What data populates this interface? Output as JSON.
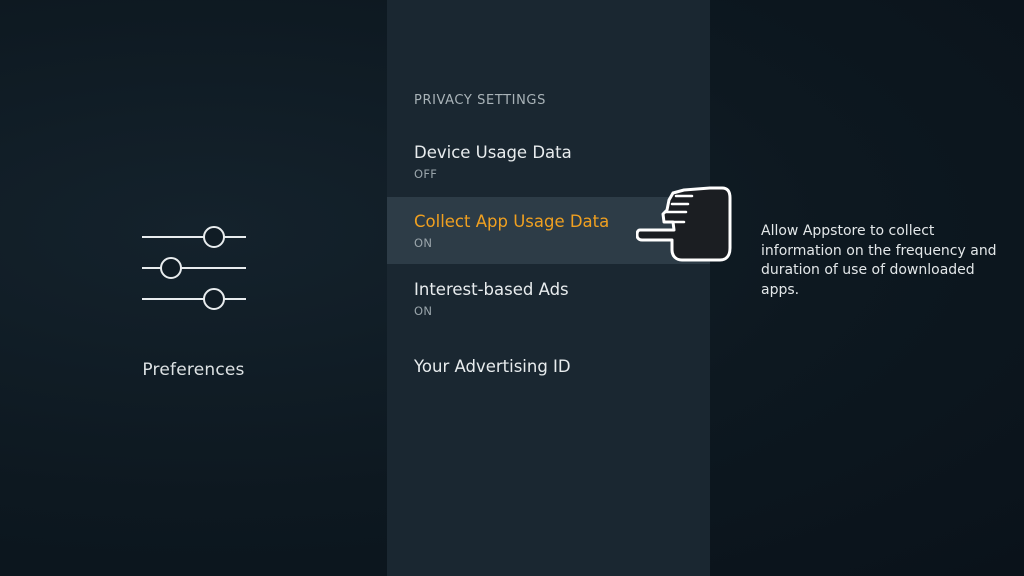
{
  "sidebar": {
    "category_label": "Preferences",
    "icon": "sliders-icon"
  },
  "settings": {
    "section_header": "PRIVACY SETTINGS",
    "items": [
      {
        "title": "Device Usage Data",
        "status": "OFF",
        "selected": false
      },
      {
        "title": "Collect App Usage Data",
        "status": "ON",
        "selected": true
      },
      {
        "title": "Interest-based Ads",
        "status": "ON",
        "selected": false
      },
      {
        "title": "Your Advertising ID",
        "status": "",
        "selected": false
      }
    ]
  },
  "description": {
    "text": "Allow Appstore to collect information on the frequency and duration of use of downloaded apps."
  },
  "pointer": {
    "icon": "pointing-hand-icon"
  },
  "colors": {
    "accent": "#f0a020",
    "panel": "#1a2731",
    "highlight": "#2d3c47",
    "background": "#0d1820"
  }
}
